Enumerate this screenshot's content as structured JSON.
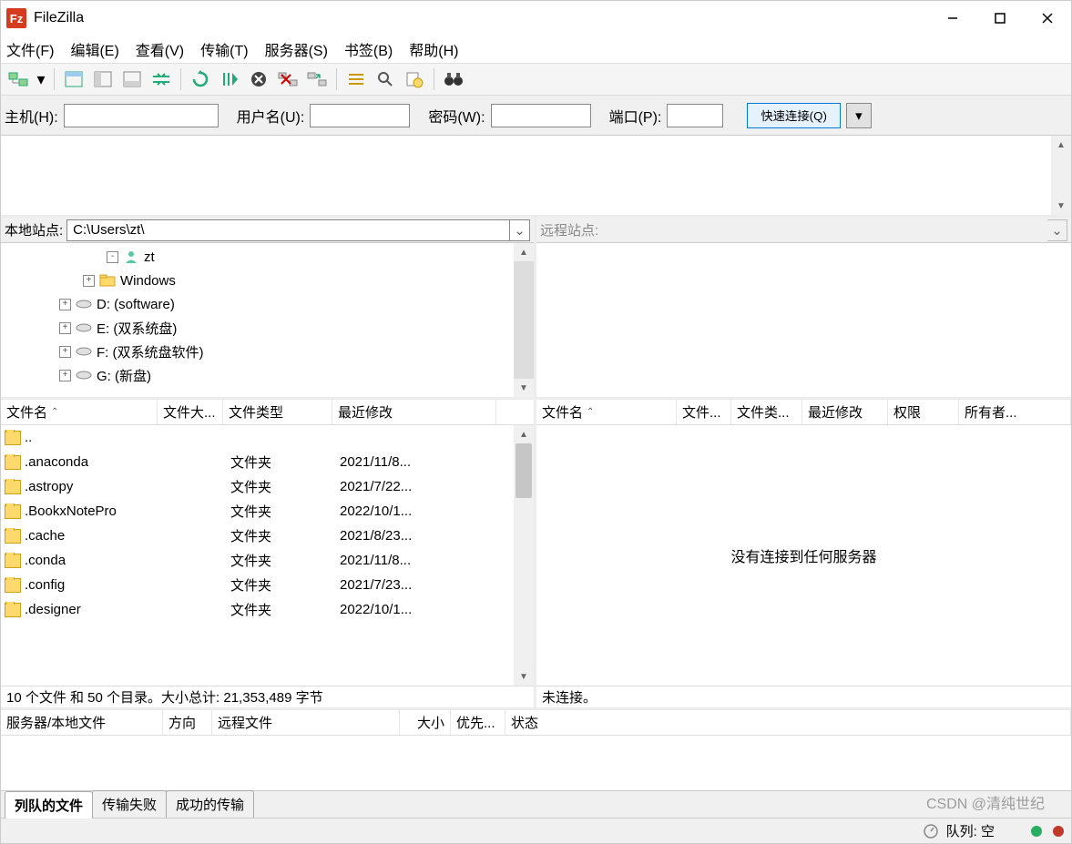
{
  "titlebar": {
    "app": "FileZilla"
  },
  "menu": [
    "文件(F)",
    "编辑(E)",
    "查看(V)",
    "传输(T)",
    "服务器(S)",
    "书签(B)",
    "帮助(H)"
  ],
  "qc": {
    "host": "主机(H):",
    "user": "用户名(U):",
    "pass": "密码(W):",
    "port": "端口(P):",
    "connect": "快速连接(Q)"
  },
  "local_site_label": "本地站点:",
  "local_site_path": "C:\\Users\\zt\\",
  "remote_site_label": "远程站点:",
  "tree": [
    {
      "indent": 112,
      "exp": "-",
      "icon": "user",
      "label": "zt"
    },
    {
      "indent": 86,
      "exp": "+",
      "icon": "folder",
      "label": "Windows"
    },
    {
      "indent": 60,
      "exp": "+",
      "icon": "drive",
      "label": "D: (software)"
    },
    {
      "indent": 60,
      "exp": "+",
      "icon": "drive",
      "label": "E: (双系统盘)"
    },
    {
      "indent": 60,
      "exp": "+",
      "icon": "drive",
      "label": "F: (双系统盘软件)"
    },
    {
      "indent": 60,
      "exp": "+",
      "icon": "drive",
      "label": "G: (新盘)"
    }
  ],
  "local_cols": {
    "name": "文件名",
    "size": "文件大...",
    "type": "文件类型",
    "mod": "最近修改"
  },
  "remote_cols": {
    "name": "文件名",
    "size": "文件...",
    "type": "文件类...",
    "mod": "最近修改",
    "perm": "权限",
    "owner": "所有者..."
  },
  "files": [
    {
      "name": "..",
      "type": "",
      "mod": ""
    },
    {
      "name": ".anaconda",
      "type": "文件夹",
      "mod": "2021/11/8..."
    },
    {
      "name": ".astropy",
      "type": "文件夹",
      "mod": "2021/7/22..."
    },
    {
      "name": ".BookxNotePro",
      "type": "文件夹",
      "mod": "2022/10/1..."
    },
    {
      "name": ".cache",
      "type": "文件夹",
      "mod": "2021/8/23..."
    },
    {
      "name": ".conda",
      "type": "文件夹",
      "mod": "2021/11/8..."
    },
    {
      "name": ".config",
      "type": "文件夹",
      "mod": "2021/7/23..."
    },
    {
      "name": ".designer",
      "type": "文件夹",
      "mod": "2022/10/1..."
    }
  ],
  "local_status": "10 个文件 和 50 个目录。大小总计: 21,353,489 字节",
  "remote_msg": "没有连接到任何服务器",
  "remote_status": "未连接。",
  "queue_cols": {
    "a": "服务器/本地文件",
    "b": "方向",
    "c": "远程文件",
    "d": "大小",
    "e": "优先...",
    "f": "状态"
  },
  "tabs": {
    "a": "列队的文件",
    "b": "传输失败",
    "c": "成功的传输"
  },
  "bottom": {
    "queue": "队列: 空"
  },
  "watermark": "CSDN @清纯世纪"
}
